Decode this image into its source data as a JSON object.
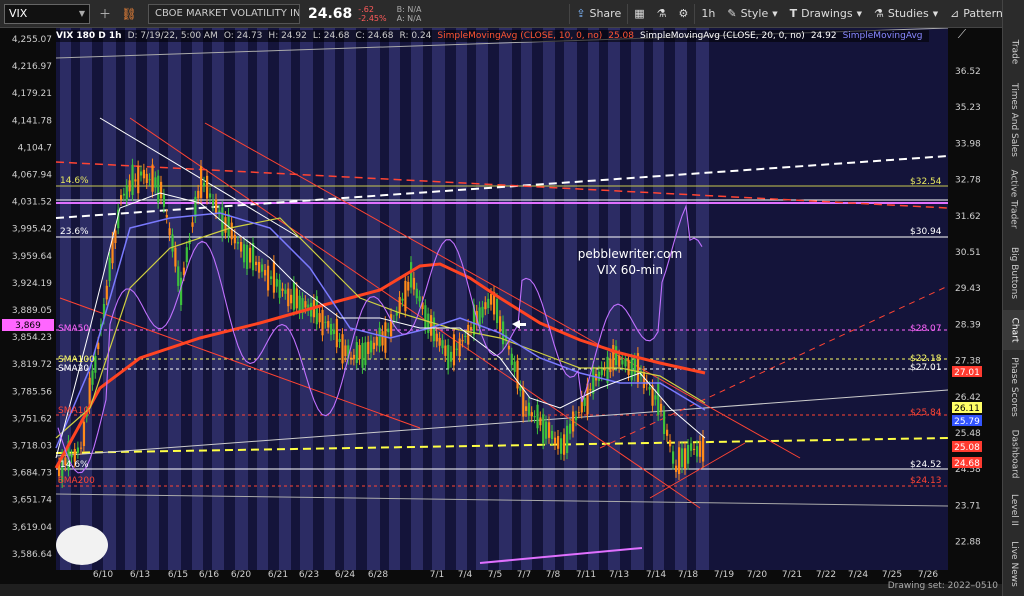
{
  "toolbar": {
    "symbol": "VIX",
    "company": "CBOE MARKET VOLATILITY INDEX",
    "last": "24.68",
    "change": "-.62",
    "change_pct": "-2.45%",
    "bid": "B: N/A",
    "ask": "A: N/A",
    "share": "Share",
    "interval": "1h",
    "style": "Style",
    "drawings": "Drawings",
    "studies": "Studies",
    "patterns": "Patterns"
  },
  "header": {
    "title": "VIX 180 D 1h",
    "date": "D: 7/19/22, 5:00 AM",
    "open": "O: 24.73",
    "high": "H: 24.92",
    "low": "L: 24.68",
    "close": "C: 24.68",
    "range": "R: 0.24",
    "sma10": "SimpleMovingAvg (CLOSE, 10, 0, no)",
    "sma10_val": "25.08",
    "sma20": "SimpleMovingAvg (CLOSE, 20, 0, no)",
    "sma20_val": "24.92",
    "sma_other": "SimpleMovingAvg"
  },
  "watermark": {
    "line1": "pebblewriter.com",
    "line2": "VIX 60-min"
  },
  "left_axis": [
    "4,255.07",
    "4,216.97",
    "4,179.21",
    "4,141.78",
    "4,104.7",
    "4,067.94",
    "4,031.52",
    "3,995.42",
    "3,959.64",
    "3,924.19",
    "3,889.05",
    "3,854.23",
    "3,819.72",
    "3,785.56",
    "3,751.62",
    "3,718.03",
    "3,684.73",
    "3,651.74",
    "3,619.04",
    "3,586.64"
  ],
  "right_axis": [
    "36.52",
    "35.23",
    "33.98",
    "32.78",
    "31.62",
    "30.51",
    "29.43",
    "28.39",
    "27.38",
    "26.42",
    "25.48",
    "24.58",
    "23.71",
    "22.88"
  ],
  "x_axis": [
    "6/10",
    "6/13",
    "6/15",
    "6/16",
    "6/20",
    "6/21",
    "6/23",
    "6/24",
    "6/28",
    "7/1",
    "7/4",
    "7/5",
    "7/7",
    "7/8",
    "7/11",
    "7/13",
    "7/14",
    "7/18",
    "7/19",
    "7/20",
    "7/21",
    "7/22",
    "7/24",
    "7/25",
    "7/26"
  ],
  "left_labels": {
    "fib_146_top": "14.6%",
    "fib_236": "23.6%",
    "spx_price": "3,869",
    "sma50": "SMA50",
    "sma100": "SMA100",
    "sma20": "SMA20",
    "sma10": "SMA10",
    "fib_146_bottom": "14.6%",
    "sma_bottom": "SMA200"
  },
  "right_tags": {
    "t1": "$32.54",
    "t2": "$30.94",
    "t3": "$28.07",
    "t4": "$22.18",
    "t5": "$27.01",
    "t6": "27.01",
    "t7": "$25.84",
    "t8": "26.11",
    "t9": "25.79",
    "t10": "25.08",
    "t11": "$24.52",
    "t12": "24.68",
    "t13": "$24.13"
  },
  "side_tabs": [
    "Trade",
    "Times And Sales",
    "Active Trader",
    "Big Buttons",
    "Chart",
    "Phase Scores",
    "Dashboard",
    "Level II",
    "Live News"
  ],
  "footer": {
    "drawing_set": "Drawing set: 2022–0510"
  },
  "colors": {
    "candle_up": "#3cc03c",
    "candle_down": "#ff8a1a",
    "sma50": "#ff4422",
    "sma20": "#d0d040",
    "vix_line": "#c070ff",
    "yellow_tag": "#ffff66",
    "red_tag": "#ff3b30",
    "blue_tag": "#3355ff"
  }
}
